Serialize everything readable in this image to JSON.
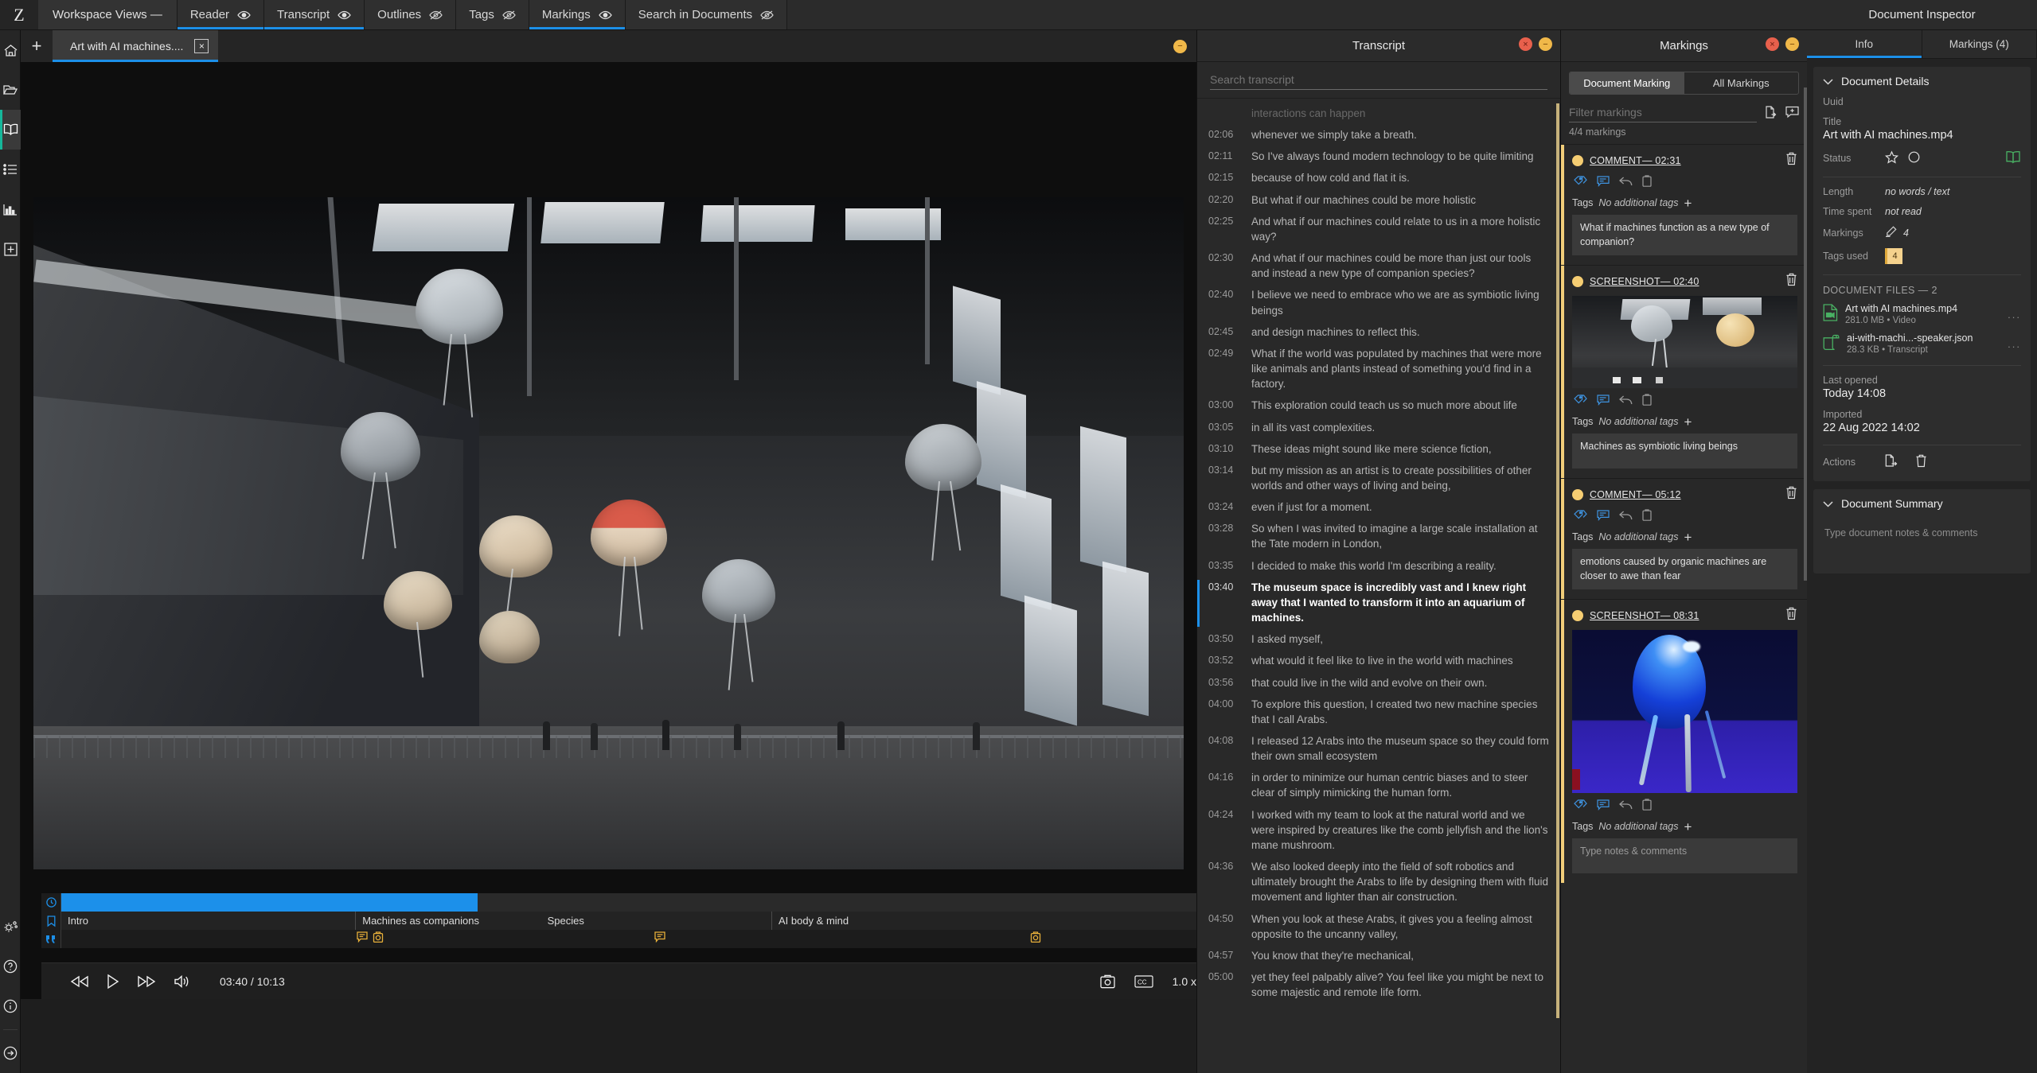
{
  "app": {
    "logo": "Z"
  },
  "menubar": {
    "workspace_label": "Workspace Views —",
    "tabs": [
      {
        "label": "Reader",
        "visible": true,
        "active": true
      },
      {
        "label": "Transcript",
        "visible": true,
        "active": true
      },
      {
        "label": "Outlines",
        "visible": false,
        "active": false
      },
      {
        "label": "Tags",
        "visible": false,
        "active": false
      },
      {
        "label": "Markings",
        "visible": true,
        "active": true
      },
      {
        "label": "Search in Documents",
        "visible": false,
        "active": false
      }
    ],
    "inspector_title": "Document Inspector"
  },
  "doctab": {
    "title": "Art with AI machines....",
    "close": "×",
    "add": "+"
  },
  "player": {
    "current_time": "03:40",
    "total_time": "10:13",
    "time_display": "03:40 / 10:13",
    "speed": "1.0 x",
    "progress_percent": 36,
    "chapters": [
      {
        "label": "Intro",
        "start_percent": 0,
        "width_percent": 25.5
      },
      {
        "label": "Machines as companions",
        "start_percent": 25.5,
        "width_percent": 21.7
      },
      {
        "label": "Species",
        "start_percent": 41.5,
        "width_percent": 20.0
      },
      {
        "label": "AI body & mind",
        "start_percent": 61.5,
        "width_percent": 38.5
      }
    ],
    "marks": [
      {
        "type": "comment",
        "position_percent": 26.0
      },
      {
        "type": "screenshot",
        "position_percent": 27.4
      },
      {
        "type": "comment",
        "position_percent": 51.8
      },
      {
        "type": "screenshot",
        "position_percent": 84.3
      }
    ]
  },
  "transcript": {
    "panel_title": "Transcript",
    "search_placeholder": "Search transcript",
    "lines": [
      {
        "time": "",
        "text": "interactions can happen",
        "state": "faded"
      },
      {
        "time": "02:06",
        "text": "whenever we simply take a breath.",
        "state": "normal"
      },
      {
        "time": "02:11",
        "text": "So I've always found modern technology to be quite limiting",
        "state": "normal"
      },
      {
        "time": "02:15",
        "text": "because of how cold and flat it is.",
        "state": "normal"
      },
      {
        "time": "02:20",
        "text": "But what if our machines could be more holistic",
        "state": "normal"
      },
      {
        "time": "02:25",
        "text": "And what if our machines could relate to us in a more holistic way?",
        "state": "normal"
      },
      {
        "time": "02:30",
        "text": "And what if our machines could be more than just our tools and instead a new type of companion species?",
        "state": "normal"
      },
      {
        "time": "02:40",
        "text": "I believe we need to embrace who we are as symbiotic living beings",
        "state": "normal"
      },
      {
        "time": "02:45",
        "text": "and design machines to reflect this.",
        "state": "normal"
      },
      {
        "time": "02:49",
        "text": "What if the world was populated by machines that were more like animals and plants instead of something you'd find in a factory.",
        "state": "normal"
      },
      {
        "time": "03:00",
        "text": "This exploration could teach us so much more about life",
        "state": "normal"
      },
      {
        "time": "03:05",
        "text": "in all its vast complexities.",
        "state": "normal"
      },
      {
        "time": "03:10",
        "text": "These ideas might sound like mere science fiction,",
        "state": "normal"
      },
      {
        "time": "03:14",
        "text": "but my mission as an artist is to create possibilities of other worlds and other ways of living and being,",
        "state": "normal"
      },
      {
        "time": "03:24",
        "text": "even if just for a moment.",
        "state": "normal"
      },
      {
        "time": "03:28",
        "text": "So when I was invited to imagine a large scale installation at the Tate modern in London,",
        "state": "normal"
      },
      {
        "time": "03:35",
        "text": "I decided to make this world I'm describing a reality.",
        "state": "normal"
      },
      {
        "time": "03:40",
        "text": "The museum space is incredibly vast and I knew right away that I wanted to transform it into an aquarium of machines.",
        "state": "current"
      },
      {
        "time": "03:50",
        "text": "I asked myself,",
        "state": "normal"
      },
      {
        "time": "03:52",
        "text": "what would it feel like to live in the world with machines",
        "state": "normal"
      },
      {
        "time": "03:56",
        "text": "that could live in the wild and evolve on their own.",
        "state": "normal"
      },
      {
        "time": "04:00",
        "text": "To explore this question, I created two new machine species that I call Arabs.",
        "state": "normal"
      },
      {
        "time": "04:08",
        "text": "I released 12 Arabs into the museum space so they could form their own small ecosystem",
        "state": "normal"
      },
      {
        "time": "04:16",
        "text": "in order to minimize our human centric biases and to steer clear of simply mimicking the human form.",
        "state": "normal"
      },
      {
        "time": "04:24",
        "text": "I worked with my team to look at the natural world and we were inspired by creatures like the comb jellyfish and the lion's mane mushroom.",
        "state": "normal"
      },
      {
        "time": "04:36",
        "text": "We also looked deeply into the field of soft robotics and ultimately brought the Arabs to life by designing them with fluid movement and lighter than air construction.",
        "state": "normal"
      },
      {
        "time": "04:50",
        "text": "When you look at these Arabs, it gives you a feeling almost opposite to the uncanny valley,",
        "state": "normal"
      },
      {
        "time": "04:57",
        "text": "You know that they're mechanical,",
        "state": "normal"
      },
      {
        "time": "05:00",
        "text": "yet they feel palpably alive? You feel like you might be next to some majestic and remote life form.",
        "state": "normal"
      }
    ]
  },
  "markings": {
    "panel_title": "Markings",
    "segments": [
      {
        "label": "Document Marking",
        "selected": true
      },
      {
        "label": "All Markings",
        "selected": false
      }
    ],
    "filter_placeholder": "Filter markings",
    "count_text": "4/4 markings",
    "tags_label": "Tags",
    "no_tags_text": "No additional tags",
    "add_tag": "+",
    "note_placeholder": "Type notes & comments",
    "items": [
      {
        "kind": "COMMENT—",
        "time": "02:31",
        "has_image": false,
        "note": "What if machines function as a new type of companion?"
      },
      {
        "kind": "SCREENSHOT—",
        "time": "02:40",
        "has_image": true,
        "image": "museum-jellyfish-thumb",
        "note": "Machines as symbiotic living beings"
      },
      {
        "kind": "COMMENT—",
        "time": "05:12",
        "has_image": false,
        "note": "emotions caused by organic machines are closer to awe than fear"
      },
      {
        "kind": "SCREENSHOT—",
        "time": "08:31",
        "has_image": true,
        "image": "blue-machine-thumb",
        "note": ""
      }
    ]
  },
  "inspector": {
    "tabs": [
      {
        "label": "Info",
        "active": true
      },
      {
        "label": "Markings (4)",
        "active": false
      }
    ],
    "details": {
      "header": "Document Details",
      "uuid_label": "Uuid",
      "uuid_value": "",
      "title_label": "Title",
      "title_value": "Art with AI machines.mp4",
      "status_label": "Status",
      "length_label": "Length",
      "length_value": "no words / text",
      "time_spent_label": "Time spent",
      "time_spent_value": "not read",
      "markings_label": "Markings",
      "markings_value": "4",
      "tags_used_label": "Tags used",
      "tags_used_value": "4",
      "files_header": "DOCUMENT FILES — 2",
      "files": [
        {
          "name": "Art with AI machines.mp4",
          "meta": "281.0 MB • Video",
          "icon": "video-file-icon"
        },
        {
          "name": "ai-with-machi...-speaker.json",
          "meta": "28.3 KB • Transcript",
          "icon": "transcript-file-icon"
        }
      ],
      "last_opened_label": "Last opened",
      "last_opened_value": "Today 14:08",
      "imported_label": "Imported",
      "imported_value": "22 Aug 2022 14:02",
      "actions_label": "Actions"
    },
    "summary": {
      "header": "Document Summary",
      "placeholder": "Type document notes & comments"
    }
  },
  "colors": {
    "accent_blue": "#1c8fe8",
    "marking_yellow": "#f5cd72",
    "green_file": "#49b063",
    "teal_selection": "#16b79a"
  }
}
